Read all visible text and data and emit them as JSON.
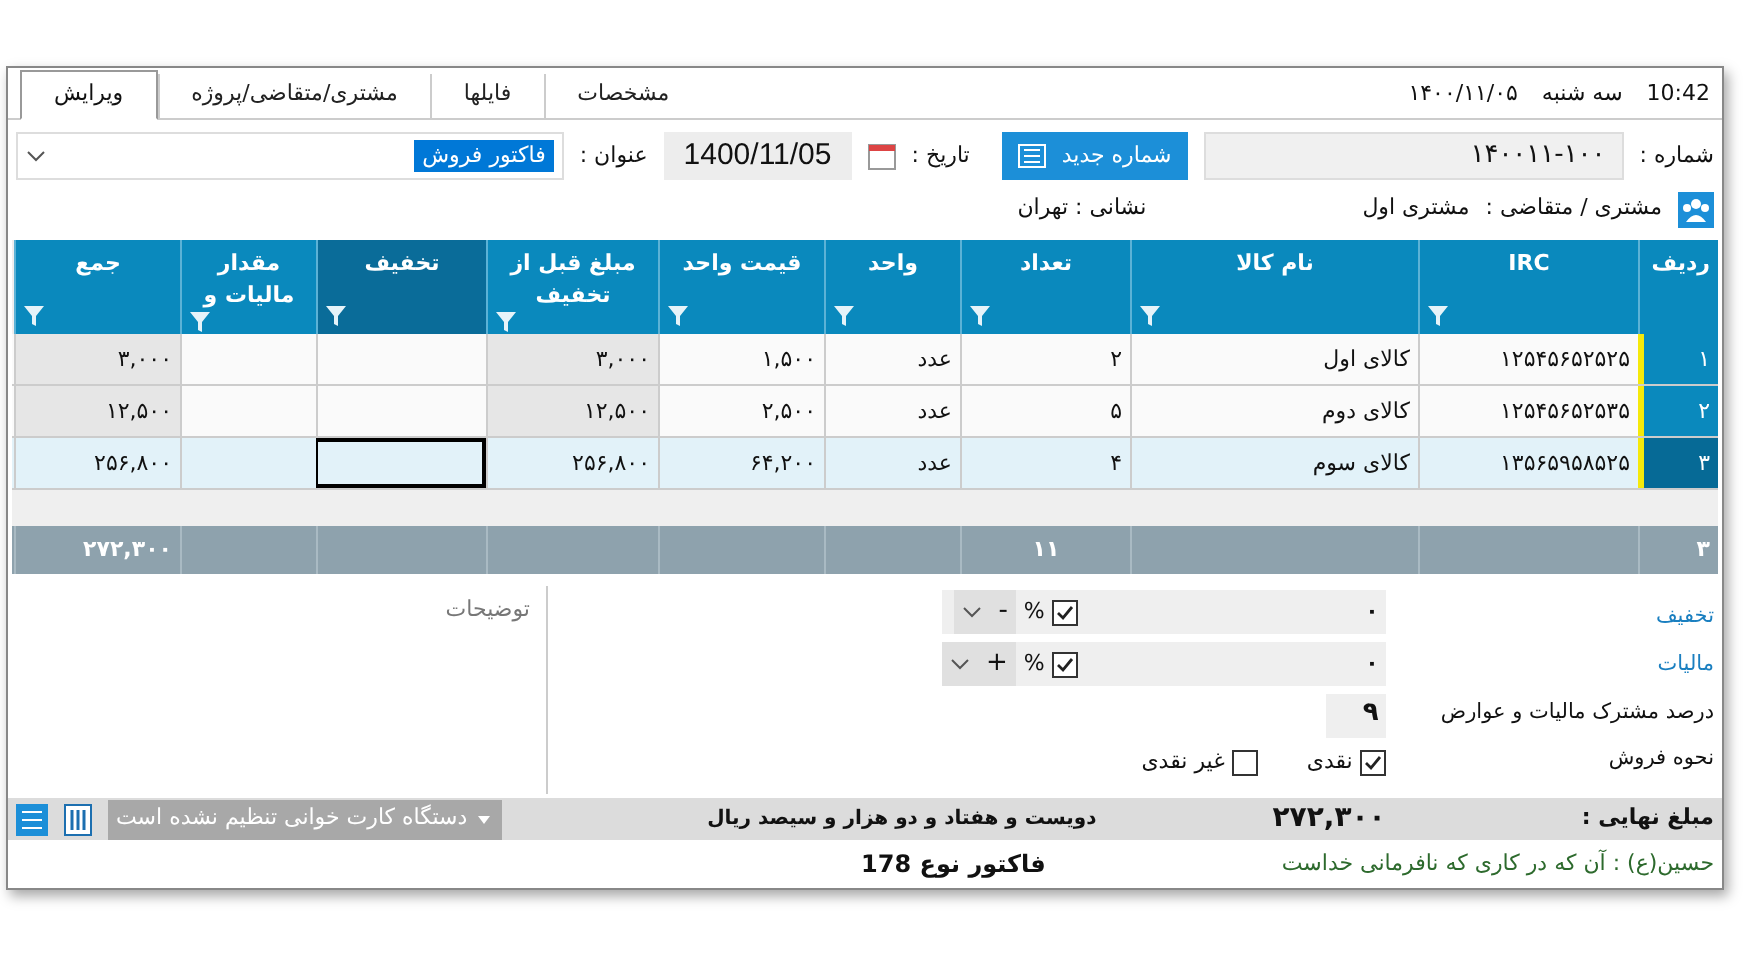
{
  "header": {
    "time": "10:42",
    "weekday": "سه شنبه",
    "date": "۱۴۰۰/۱۱/۰۵"
  },
  "tabs": [
    {
      "label": "مشخصات",
      "selected": false
    },
    {
      "label": "فایلها",
      "selected": false
    },
    {
      "label": "مشتری/متقاضی/پروژه",
      "selected": false
    },
    {
      "label": "ویرایش",
      "selected": true
    }
  ],
  "form": {
    "number_label": "شماره :",
    "number": "۱۴۰۰۱۱-۱۰۰",
    "new_number_button": "شماره جدید",
    "date_label": "تاریخ :",
    "date": "1400/11/05",
    "title_label": "عنوان :",
    "title": "فاکتور فروش",
    "customer_label": "مشتری / متقاضی :",
    "customer": "مشتری اول",
    "address": "نشانی : تهران"
  },
  "table": {
    "columns": [
      {
        "label": "ردیف",
        "kind": "row",
        "total": "۳"
      },
      {
        "label": "IRC",
        "kind": "text"
      },
      {
        "label": "نام کالا",
        "kind": "text"
      },
      {
        "label": "تعداد",
        "kind": "text",
        "total": "۱۱"
      },
      {
        "label": "واحد",
        "kind": "text"
      },
      {
        "label": "قیمت واحد",
        "kind": "text"
      },
      {
        "label": "مبلغ قبل از تخفیف",
        "kind": "computed"
      },
      {
        "label": "تخفیف",
        "kind": "text"
      },
      {
        "label": "مقدار مالیات و",
        "kind": "text"
      },
      {
        "label": "جمع",
        "kind": "computed",
        "total": "۲۷۲,۳۰۰"
      }
    ],
    "rows": [
      {
        "selected": false,
        "cells": [
          "۱",
          "۱۲۵۴۵۶۵۲۵۲۵",
          "کالای اول",
          "۲",
          "عدد",
          "۱,۵۰۰",
          "۳,۰۰۰",
          "",
          "",
          "۳,۰۰۰"
        ]
      },
      {
        "selected": false,
        "cells": [
          "۲",
          "۱۲۵۴۵۶۵۲۵۳۵",
          "کالای دوم",
          "۵",
          "عدد",
          "۲,۵۰۰",
          "۱۲,۵۰۰",
          "",
          "",
          "۱۲,۵۰۰"
        ]
      },
      {
        "selected": true,
        "cells": [
          "۳",
          "۱۳۵۶۵۹۵۸۵۲۵",
          "کالای سوم",
          "۴",
          "عدد",
          "۶۴,۲۰۰",
          "۲۵۶,۸۰۰",
          "",
          "",
          "۲۵۶,۸۰۰"
        ]
      }
    ]
  },
  "notes": {
    "placeholder": "توضیحات"
  },
  "discount": {
    "label": "تخفیف",
    "value": "۰",
    "percent": true,
    "unit": "%",
    "sign": "-"
  },
  "tax": {
    "label": "مالیات",
    "value": "۰",
    "percent": true,
    "unit": "%",
    "sign": "+"
  },
  "shared_tax": {
    "label": "درصد مشترک مالیات و عوارض",
    "value": "۹"
  },
  "sale_type": {
    "label": "نحوه فروش",
    "options": [
      {
        "label": "نقدی",
        "checked": true
      },
      {
        "label": "غیر نقدی",
        "checked": false
      }
    ]
  },
  "status": {
    "final_label": "مبلغ نهایی :",
    "final": "۲۷۲,۳۰۰",
    "in_words": "دویست و هفتاد و دو هزار و سیصد ریال",
    "card_reader": "دستگاه کارت خوانی تنظیم نشده است"
  },
  "footer": {
    "quote": "حسین(ع) : آن که در کاری که نافرمانی خداست",
    "invoice_type": "فاکتور نوع 178"
  }
}
